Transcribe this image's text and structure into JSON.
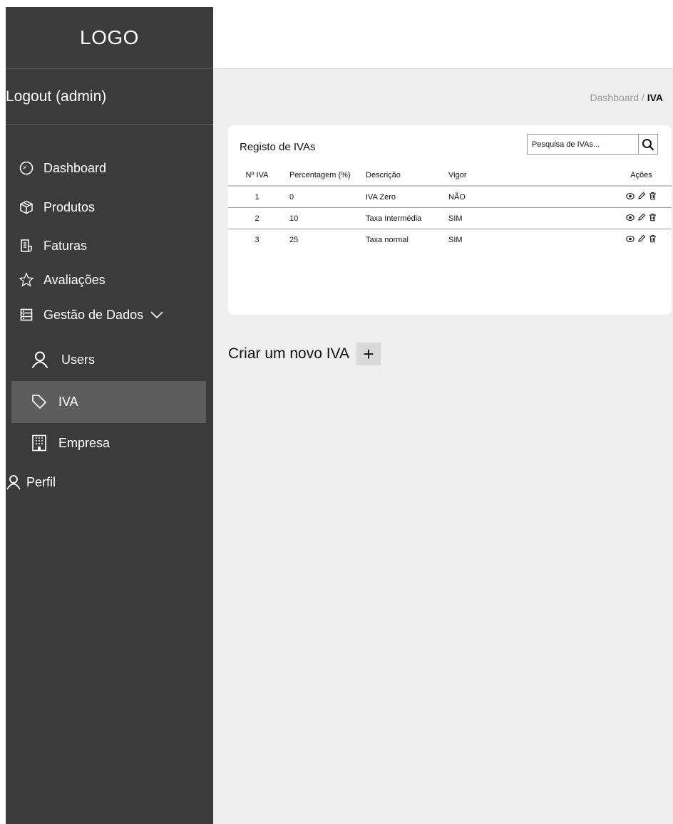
{
  "sidebar": {
    "logo": "LOGO",
    "logout": "Logout (admin)",
    "items": [
      {
        "label": "Dashboard",
        "icon": "gauge-icon"
      },
      {
        "label": "Produtos",
        "icon": "box-icon"
      },
      {
        "label": "Faturas",
        "icon": "invoice-icon"
      },
      {
        "label": "Avaliações",
        "icon": "star-icon"
      },
      {
        "label": "Gestão de Dados",
        "icon": "database-icon"
      },
      {
        "label": "Users",
        "icon": "user-icon"
      },
      {
        "label": "IVA",
        "icon": "tag-icon"
      },
      {
        "label": "Empresa",
        "icon": "building-icon"
      },
      {
        "label": "Perfil",
        "icon": "user-icon"
      }
    ]
  },
  "breadcrumb": {
    "parent": "Dashboard",
    "sep": " / ",
    "current": "IVA"
  },
  "card": {
    "title": "Registo de IVAs",
    "search_placeholder": "Pesquisa de IVAs...",
    "columns": [
      "Nº IVA",
      "Percentagem (%)",
      "Descrição",
      "Vigor",
      "Ações"
    ],
    "rows": [
      {
        "num": "1",
        "pct": "0",
        "desc": "IVA Zero",
        "vigor": "NÃO"
      },
      {
        "num": "2",
        "pct": "10",
        "desc": "Taxa Intermédia",
        "vigor": "SIM"
      },
      {
        "num": "3",
        "pct": "25",
        "desc": "Taxa normal",
        "vigor": "SIM"
      }
    ]
  },
  "create": {
    "label": "Criar um novo IVA",
    "plus": "+"
  },
  "colors": {
    "sidebar": "#3b3b3b",
    "active": "#5d5d5d",
    "content_bg": "#eeeeee"
  }
}
